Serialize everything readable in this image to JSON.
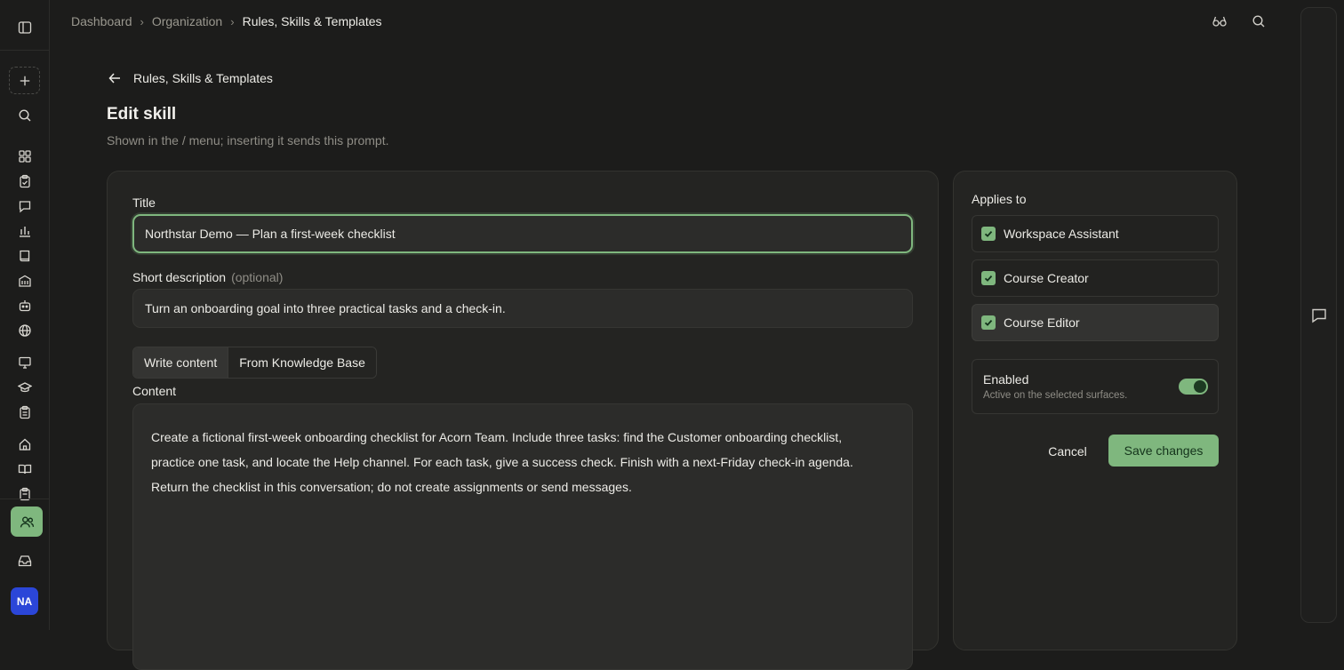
{
  "breadcrumb": {
    "items": [
      "Dashboard",
      "Organization"
    ],
    "current": "Rules, Skills & Templates"
  },
  "rail": {
    "avatar_initials": "NA",
    "icons": [
      "sidebar-toggle-icon",
      "plus-icon",
      "search-icon",
      "dashboard-icon",
      "clipboard-check-icon",
      "message-icon",
      "bar-chart-icon",
      "book-icon",
      "building-icon",
      "bot-icon",
      "globe-icon",
      "presentation-icon",
      "graduation-cap-icon",
      "clipboard-list-icon",
      "home-icon",
      "book-open-icon",
      "clipboard-icon",
      "users-icon",
      "inbox-icon"
    ]
  },
  "header": {
    "back_label": "Rules, Skills & Templates",
    "title": "Edit skill",
    "subtitle": "Shown in the / menu; inserting it sends this prompt."
  },
  "form": {
    "title_label": "Title",
    "title_value": "Northstar Demo — Plan a first-week checklist",
    "desc_label": "Short description",
    "desc_optional": "(optional)",
    "desc_value": "Turn an onboarding goal into three practical tasks and a check-in.",
    "tabs": {
      "write": "Write content",
      "kb": "From Knowledge Base"
    },
    "content_label": "Content",
    "content_lines": [
      "Create a fictional first-week onboarding checklist for Acorn Team. Include three tasks: find the Customer onboarding checklist,",
      "practice one task, and locate the Help channel. For each task, give a success check. Finish with a next-Friday check-in agenda.",
      "Return the checklist in this conversation; do not create assignments or send messages."
    ]
  },
  "applies": {
    "title": "Applies to",
    "surfaces": [
      "Workspace Assistant",
      "Course Creator",
      "Course Editor"
    ],
    "enabled_title": "Enabled",
    "enabled_sub": "Active on the selected surfaces.",
    "enabled": true,
    "cancel": "Cancel",
    "save": "Save changes"
  },
  "colors": {
    "accent": "#7fb77e",
    "background": "#1c1c1b",
    "card": "#242422",
    "avatar": "#2b46d8"
  }
}
